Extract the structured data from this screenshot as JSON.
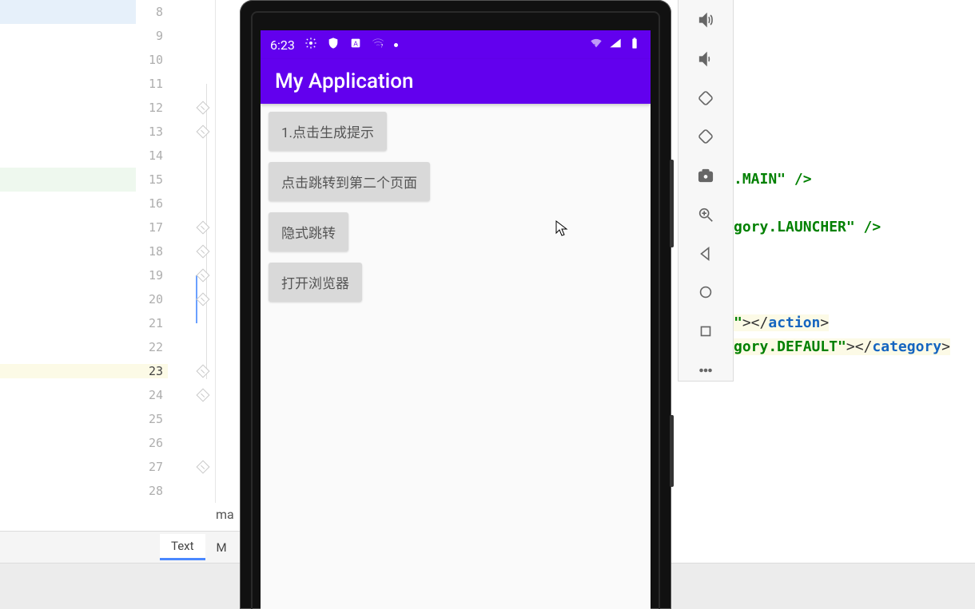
{
  "editor": {
    "line_numbers": [
      "8",
      "9",
      "10",
      "11",
      "12",
      "13",
      "14",
      "15",
      "16",
      "17",
      "18",
      "19",
      "20",
      "21",
      "22",
      "23",
      "24",
      "25",
      "26",
      "27",
      "28"
    ],
    "current_line_index": 15,
    "truncated_label": "ma",
    "tabs": {
      "text": "Text",
      "second_initial": "M"
    }
  },
  "code_peek": {
    "line1_suffix": ".MAIN\" />",
    "line2_suffix": "gory.LAUNCHER\" />",
    "line3_prefix": "\"",
    "line3_close": "></",
    "line3_tag": "action",
    "line3_end": ">",
    "line4_str": "gory.DEFAULT\"",
    "line4_close": "></",
    "line4_tag": "category",
    "line4_end": ">"
  },
  "emulator_sidebar": {
    "icons": [
      "volume-up",
      "volume-down",
      "rotate-left",
      "rotate-right",
      "camera",
      "zoom-in",
      "back",
      "home",
      "overview",
      "more"
    ]
  },
  "device": {
    "status": {
      "time": "6:23"
    },
    "app_title": "My Application",
    "buttons": [
      "1.点击生成提示",
      "点击跳转到第二个页面",
      "隐式跳转",
      "打开浏览器"
    ]
  }
}
